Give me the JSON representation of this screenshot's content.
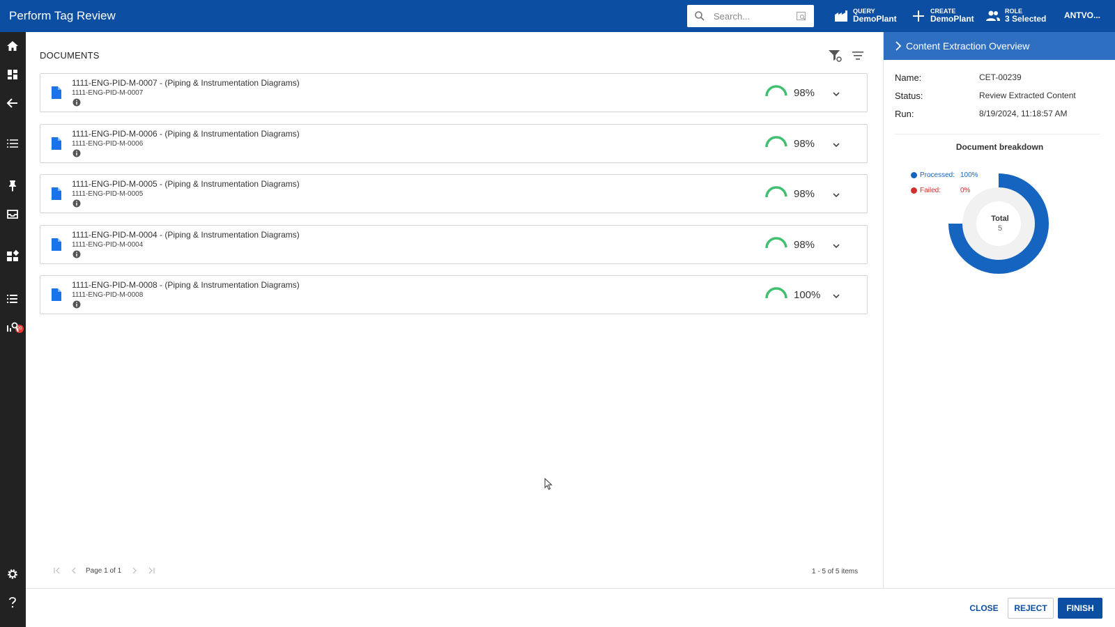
{
  "header": {
    "title": "Perform Tag Review",
    "search_placeholder": "Search...",
    "query": {
      "small": "QUERY",
      "big": "DemoPlant"
    },
    "create": {
      "small": "CREATE",
      "big": "DemoPlant"
    },
    "role": {
      "small": "ROLE",
      "big": "3 Selected"
    },
    "user": "ANTVO..."
  },
  "sidebar": {
    "icons": [
      "home-icon",
      "dashboard-icon",
      "back-arrow-icon",
      "list-icon",
      "pin-icon",
      "inbox-icon",
      "widgets-icon",
      "task-list-icon",
      "analytics-icon",
      "settings-icon",
      "help-icon"
    ],
    "badge": "20"
  },
  "main": {
    "section_title": "DOCUMENTS",
    "documents": [
      {
        "title": "1111-ENG-PID-M-0007 - (Piping & Instrumentation Diagrams)",
        "sub": "1111-ENG-PID-M-0007",
        "percent": "98%",
        "progress": 0.98
      },
      {
        "title": "1111-ENG-PID-M-0006 - (Piping & Instrumentation Diagrams)",
        "sub": "1111-ENG-PID-M-0006",
        "percent": "98%",
        "progress": 0.98
      },
      {
        "title": "1111-ENG-PID-M-0005 - (Piping & Instrumentation Diagrams)",
        "sub": "1111-ENG-PID-M-0005",
        "percent": "98%",
        "progress": 0.98
      },
      {
        "title": "1111-ENG-PID-M-0004 - (Piping & Instrumentation Diagrams)",
        "sub": "1111-ENG-PID-M-0004",
        "percent": "98%",
        "progress": 0.98
      },
      {
        "title": "1111-ENG-PID-M-0008 - (Piping & Instrumentation Diagrams)",
        "sub": "1111-ENG-PID-M-0008",
        "percent": "100%",
        "progress": 1.0
      }
    ],
    "pager": {
      "page_text": "Page 1 of 1",
      "items_text": "1 - 5 of 5 items"
    }
  },
  "panel": {
    "title": "Content Extraction Overview",
    "name_label": "Name:",
    "name_value": "CET-00239",
    "status_label": "Status:",
    "status_value": "Review Extracted Content",
    "run_label": "Run:",
    "run_value": "8/19/2024, 11:18:57 AM",
    "breakdown_title": "Document breakdown",
    "processed_label": "Processed:",
    "processed_value": "100%",
    "failed_label": "Failed:",
    "failed_value": "0%",
    "total_label": "Total",
    "total_value": "5"
  },
  "colors": {
    "brand": "#0b4ea2",
    "processed": "#1565c0",
    "failed": "#d32f2f",
    "gauge": "#3fbf6f"
  },
  "chart_data": {
    "type": "pie",
    "title": "Document breakdown",
    "categories": [
      "Processed",
      "Failed"
    ],
    "values": [
      100,
      0
    ],
    "total": 5
  },
  "footer": {
    "close": "CLOSE",
    "reject": "REJECT",
    "finish": "FINISH"
  }
}
